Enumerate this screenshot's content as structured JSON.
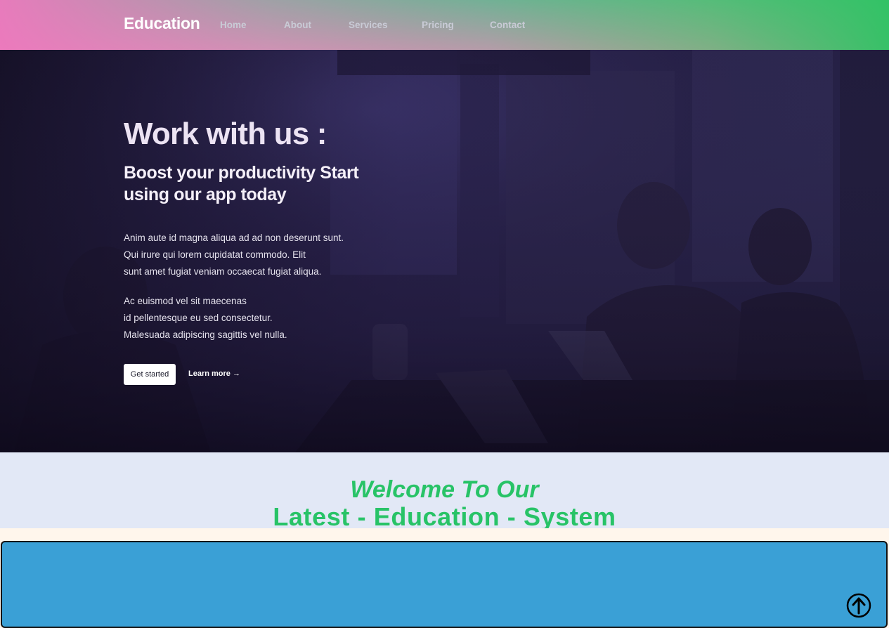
{
  "nav": {
    "brand": "Education",
    "links": [
      "Home",
      "About",
      "Services",
      "Pricing",
      "Contact"
    ]
  },
  "hero": {
    "title": "Work with us :",
    "subtitle": "Boost your productivity Start using our app today",
    "paragraph1": [
      "Anim aute id magna aliqua ad ad non deserunt sunt.",
      "Qui irure qui lorem cupidatat commodo. Elit",
      "sunt amet fugiat veniam occaecat fugiat aliqua."
    ],
    "paragraph2": [
      "Ac euismod vel sit maecenas",
      "id pellentesque eu sed consectetur.",
      "Malesuada adipiscing sagittis vel nulla."
    ],
    "primary_button": "Get started",
    "secondary_link": "Learn more →"
  },
  "welcome": {
    "line1": "Welcome To Our",
    "line2": "Latest - Education - System"
  },
  "icons": {
    "scroll_top": "arrow-up-circle-icon"
  },
  "colors": {
    "accent_green": "#28c367",
    "card_blue": "#3aa0d6",
    "welcome_bg": "#e2e8f6"
  }
}
